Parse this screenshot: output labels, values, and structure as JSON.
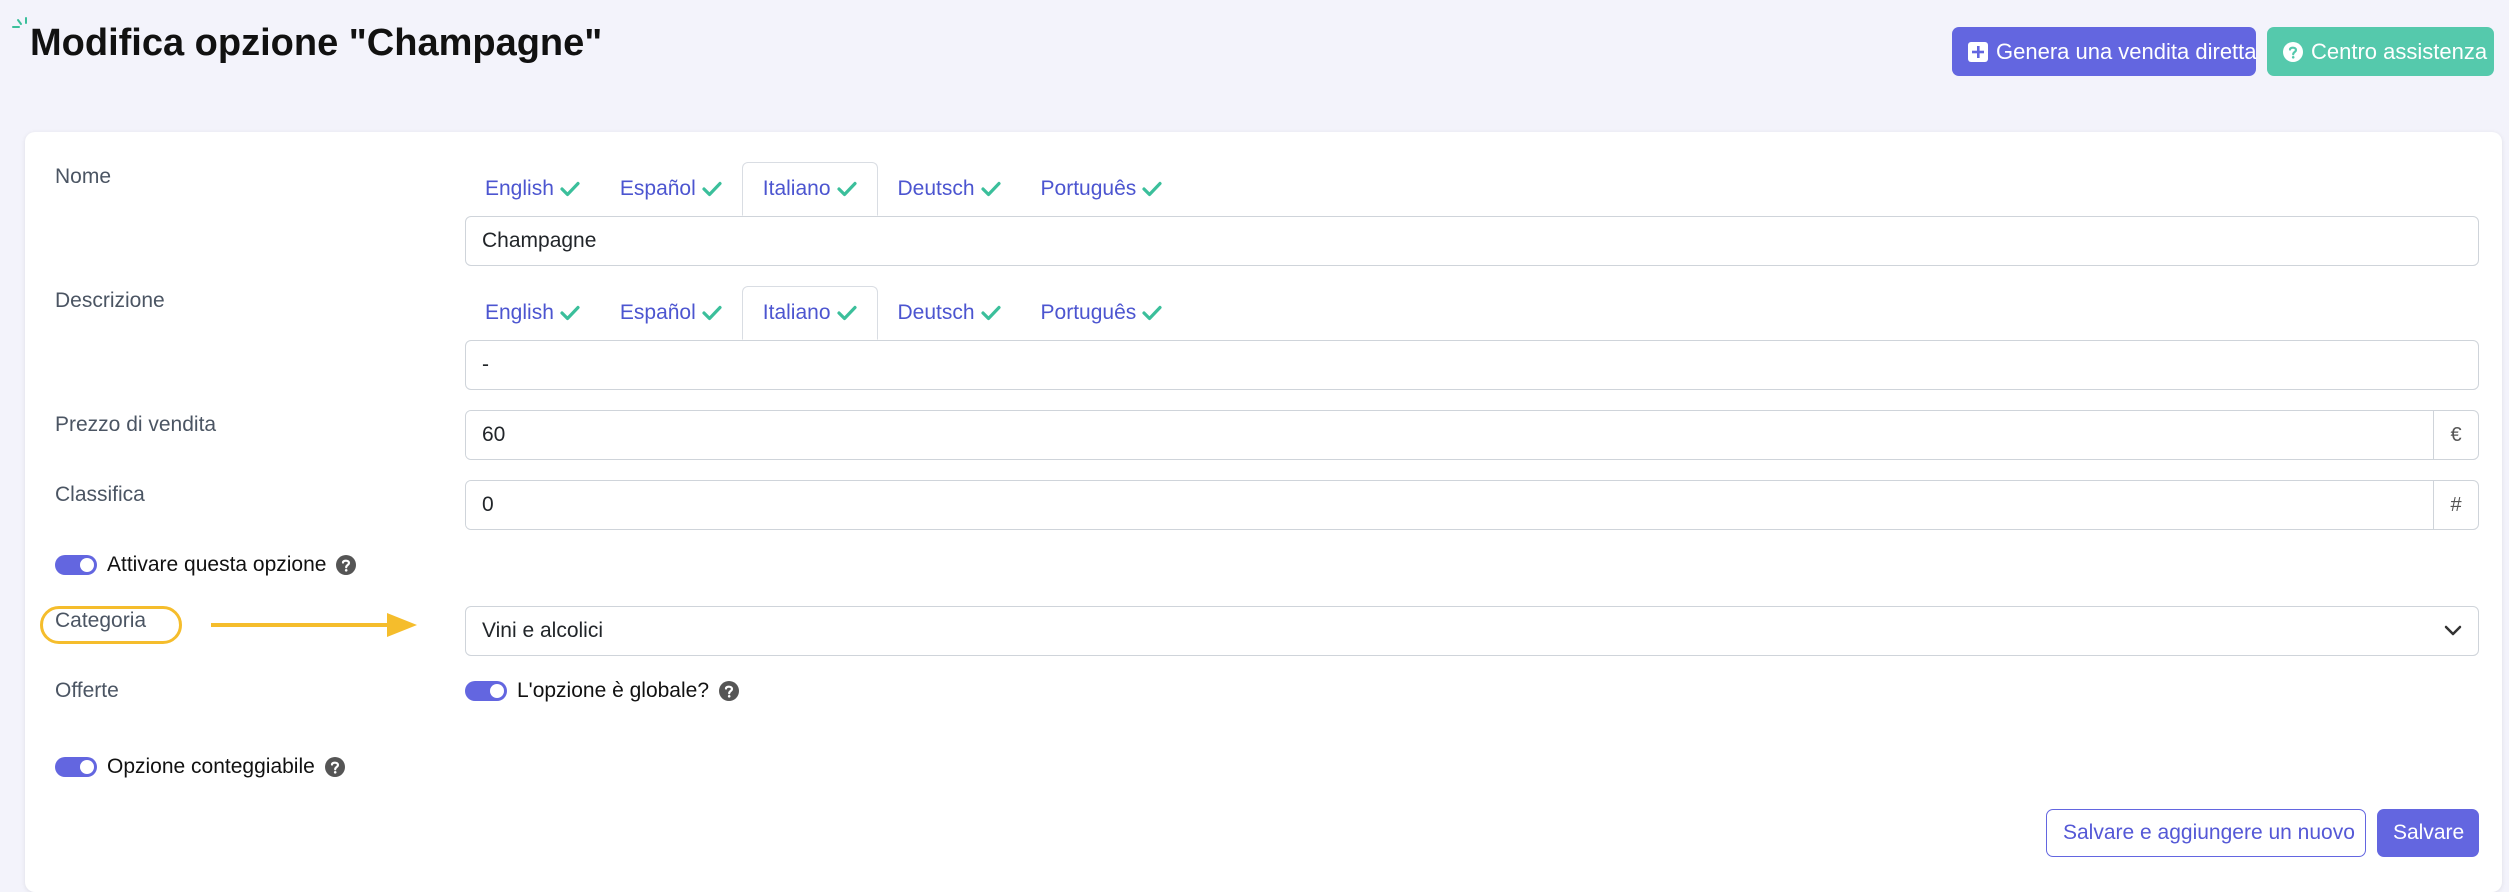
{
  "header": {
    "title": "Modifica opzione \"Champagne\"",
    "direct_sale_label": "Genera una vendita diretta",
    "help_center_label": "Centro assistenza"
  },
  "form": {
    "name": {
      "label": "Nome",
      "tabs": [
        "English",
        "Español",
        "Italiano",
        "Deutsch",
        "Português"
      ],
      "active_tab": "Italiano",
      "value": "Champagne"
    },
    "description": {
      "label": "Descrizione",
      "tabs": [
        "English",
        "Español",
        "Italiano",
        "Deutsch",
        "Português"
      ],
      "active_tab": "Italiano",
      "value": "-"
    },
    "price": {
      "label": "Prezzo di vendita",
      "value": "60",
      "addon": "€"
    },
    "ranking": {
      "label": "Classifica",
      "value": "0",
      "addon": "#"
    },
    "activate": {
      "label": "Attivare questa opzione",
      "checked": true
    },
    "category": {
      "label": "Categoria",
      "selected": "Vini e alcolici"
    },
    "offers": {
      "label": "Offerte",
      "global_label": "L'opzione è globale?",
      "checked": true
    },
    "countable": {
      "label": "Opzione conteggiabile",
      "checked": true
    }
  },
  "footer": {
    "save_new_label": "Salvare e aggiungere un nuovo",
    "save_label": "Salvare"
  },
  "colors": {
    "primary": "#6366e0",
    "success": "#55c9ac",
    "check": "#3bbf9b",
    "highlight": "#f5bd2c"
  },
  "icons": {
    "direct_sale": "plus-square-icon",
    "help_center": "question-circle-icon",
    "tab_check": "check-icon",
    "help": "question-circle-icon",
    "select": "chevron-down-icon",
    "annotation": "arrow-right-icon"
  }
}
